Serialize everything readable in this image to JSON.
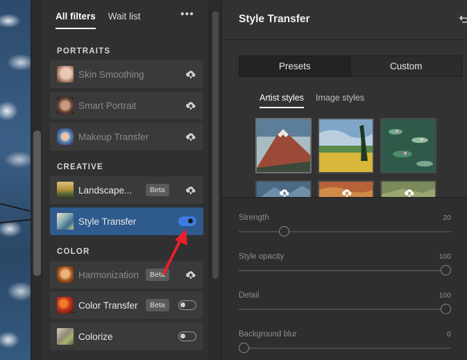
{
  "filters_panel": {
    "tabs": [
      {
        "label": "All filters",
        "active": true
      },
      {
        "label": "Wait list",
        "active": false
      }
    ],
    "more_label": "•••",
    "sections": {
      "portraits": "PORTRAITS",
      "creative": "CREATIVE",
      "color": "COLOR"
    },
    "items": [
      {
        "label": "Skin Smoothing",
        "state": "cloud",
        "icon": "cloud-download-icon"
      },
      {
        "label": "Smart Portrait",
        "state": "cloud",
        "icon": "cloud-download-icon"
      },
      {
        "label": "Makeup Transfer",
        "state": "cloud",
        "icon": "cloud-download-icon"
      },
      {
        "label": "Landscape...",
        "badge": "Beta",
        "state": "cloud",
        "icon": "cloud-download-icon"
      },
      {
        "label": "Style Transfer",
        "state": "toggle-on"
      },
      {
        "label": "Harmonization",
        "badge": "Beta",
        "state": "cloud",
        "icon": "cloud-download-icon"
      },
      {
        "label": "Color Transfer",
        "badge": "Beta",
        "state": "toggle-off"
      },
      {
        "label": "Colorize",
        "state": "toggle-off"
      }
    ]
  },
  "style_transfer": {
    "title": "Style Transfer",
    "segments": [
      {
        "label": "Presets",
        "active": true
      },
      {
        "label": "Custom",
        "active": false
      }
    ],
    "subtabs": [
      {
        "label": "Artist styles",
        "active": true
      },
      {
        "label": "Image styles",
        "active": false
      }
    ],
    "sliders": [
      {
        "label": "Strength",
        "value": "20"
      },
      {
        "label": "Style opacity",
        "value": "100"
      },
      {
        "label": "Detail",
        "value": "100"
      },
      {
        "label": "Background blur",
        "value": "0"
      }
    ]
  },
  "colors": {
    "selected_item": "#2e5a8c",
    "toggle_on": "#3b7de0",
    "annotation_arrow": "#e8202a"
  }
}
